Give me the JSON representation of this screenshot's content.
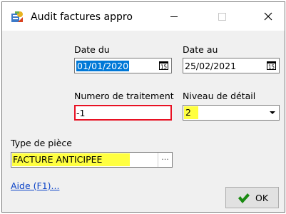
{
  "window": {
    "title": "Audit factures appro",
    "icons": {
      "app": "audit-app-icon",
      "minimize": "minimize-icon",
      "maximize": "maximize-icon",
      "close": "close-icon"
    }
  },
  "form": {
    "date_du": {
      "label": "Date du",
      "value": "01/01/2020",
      "icon": "calendar-icon"
    },
    "date_au": {
      "label": "Date au",
      "value": "25/02/2021",
      "icon": "calendar-icon"
    },
    "numero": {
      "label": "Numero de traitement",
      "value": "-1"
    },
    "niveau": {
      "label": "Niveau de détail",
      "value": "2",
      "icon": "chevron-down-icon"
    },
    "type_piece": {
      "label": "Type de pièce",
      "value": "FACTURE ANTICIPEE",
      "browse_label": "..."
    }
  },
  "footer": {
    "help_link": "Aide (F1)...",
    "ok_label": "OK",
    "ok_icon": "checkmark-icon"
  },
  "colors": {
    "selection": "#0078d7",
    "highlight": "#ffff40",
    "error_border": "#e81123",
    "link": "#0b43c7",
    "ok_check": "#1a8a12"
  }
}
